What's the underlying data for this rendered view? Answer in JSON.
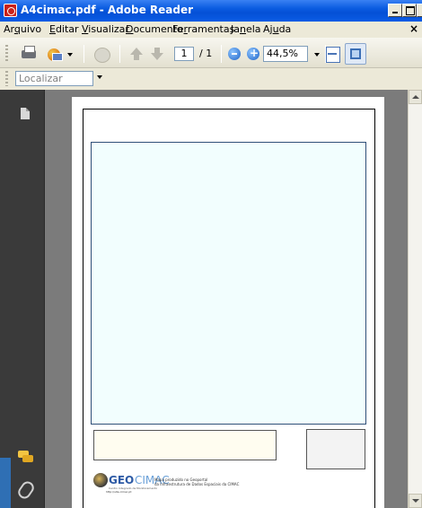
{
  "window": {
    "title": "A4cimac.pdf - Adobe Reader"
  },
  "menu": [
    {
      "pre": "Ar",
      "mn": "q",
      "post": "uivo"
    },
    {
      "pre": "",
      "mn": "E",
      "post": "ditar"
    },
    {
      "pre": "",
      "mn": "V",
      "post": "isualizar"
    },
    {
      "pre": "",
      "mn": "D",
      "post": "ocumento"
    },
    {
      "pre": "Fe",
      "mn": "r",
      "post": "ramentas"
    },
    {
      "pre": "Ja",
      "mn": "n",
      "post": "ela"
    },
    {
      "pre": "Aj",
      "mn": "u",
      "post": "da"
    }
  ],
  "toolbar": {
    "page_current": "1",
    "page_total": "/ 1",
    "zoom": "44,5%"
  },
  "find": {
    "placeholder": "Localizar"
  },
  "document": {
    "logo_geo": "GEO",
    "logo_cimac": "CIMAC",
    "logo_sub": "Centro Integrado de Monitoramento",
    "footer_line1": "Mapa produzido no Geoportal",
    "footer_line2": "da Infraestrutura de Dados Espaciais da CIMAC",
    "footer_link": "http://site.cimac.pt"
  },
  "colors": {
    "titlebar": "#0550d6",
    "map_fill": "#f2fefe",
    "legend_fill": "#fffdf0",
    "viewer_bg": "#7b7b7b"
  }
}
